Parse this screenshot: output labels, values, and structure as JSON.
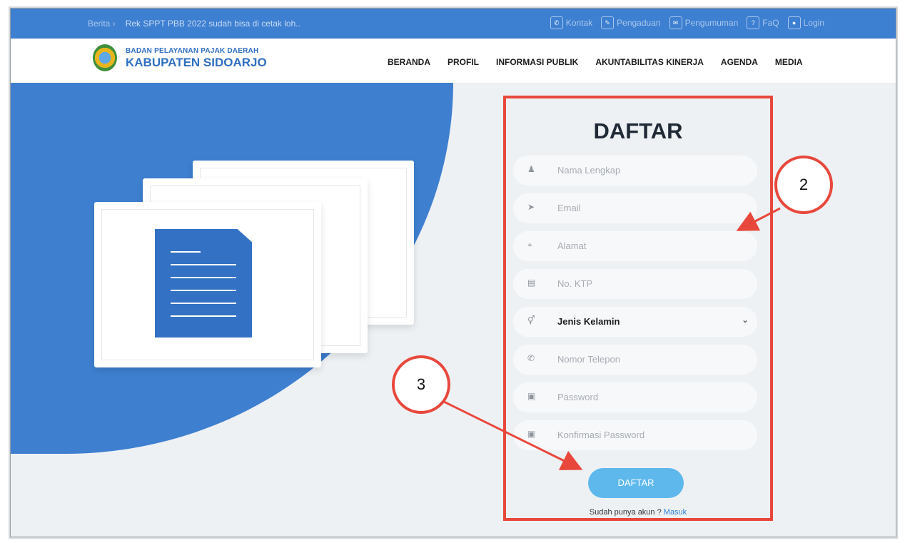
{
  "topbar": {
    "news_label": "Berita ›",
    "news_text": "Rek SPPT PBB 2022 sudah bisa di cetak loh..",
    "links": [
      {
        "icon": "phone-icon",
        "glyph": "✆",
        "label": "Kontak"
      },
      {
        "icon": "pencil-icon",
        "glyph": "✎",
        "label": "Pengaduan"
      },
      {
        "icon": "megaphone-icon",
        "glyph": "✉",
        "label": "Pengumuman"
      },
      {
        "icon": "question-icon",
        "glyph": "?",
        "label": "FaQ"
      },
      {
        "icon": "user-icon",
        "glyph": "●",
        "label": "Login"
      }
    ]
  },
  "brand": {
    "line1": "BADAN PELAYANAN PAJAK DAERAH",
    "line2": "KABUPATEN SIDOARJO"
  },
  "nav": {
    "items": [
      "BERANDA",
      "PROFIL",
      "INFORMASI PUBLIK",
      "AKUNTABILITAS KINERJA",
      "AGENDA",
      "MEDIA"
    ]
  },
  "form": {
    "title": "DAFTAR",
    "fields": [
      {
        "icon": "person-icon",
        "glyph": "♟",
        "placeholder": "Nama Lengkap"
      },
      {
        "icon": "send-icon",
        "glyph": "➤",
        "placeholder": "Email"
      },
      {
        "icon": "location-icon",
        "glyph": "⌖",
        "placeholder": "Alamat"
      },
      {
        "icon": "id-card-icon",
        "glyph": "▤",
        "placeholder": "No. KTP"
      },
      {
        "icon": "gender-icon",
        "glyph": "⚥",
        "selected": "Jenis Kelamin"
      },
      {
        "icon": "phone-icon",
        "glyph": "✆",
        "placeholder": "Nomor Telepon"
      },
      {
        "icon": "lock-icon",
        "glyph": "▣",
        "placeholder": "Password"
      },
      {
        "icon": "lock-icon",
        "glyph": "▣",
        "placeholder": "Konfirmasi Password"
      }
    ],
    "submit_label": "DAFTAR",
    "login_prompt": "Sudah punya akun ?",
    "login_link": "Masuk"
  },
  "annotations": {
    "marker_2": "2",
    "marker_3": "3"
  },
  "colors": {
    "primary_blue": "#3d7fd0",
    "annotation_red": "#e8483c",
    "button_blue": "#5eb8ec"
  }
}
